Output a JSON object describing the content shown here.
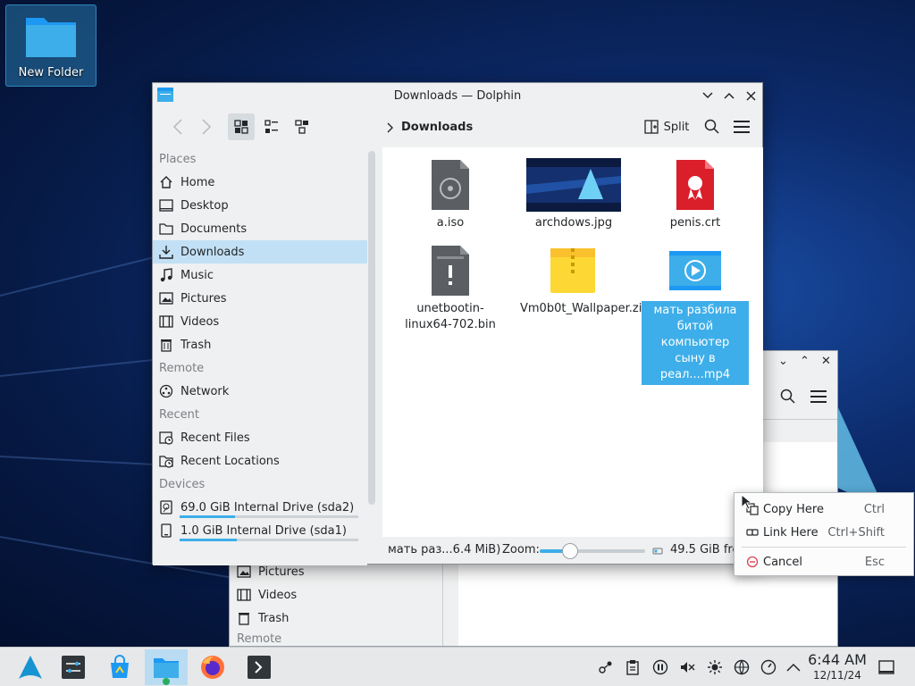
{
  "desktop": {
    "icon_label": "New Folder"
  },
  "window": {
    "title": "Downloads — Dolphin",
    "breadcrumb": "Downloads",
    "split_label": "Split"
  },
  "sidebar": {
    "places_header": "Places",
    "places": [
      "Home",
      "Desktop",
      "Documents",
      "Downloads",
      "Music",
      "Pictures",
      "Videos",
      "Trash"
    ],
    "remote_header": "Remote",
    "remote": [
      "Network"
    ],
    "recent_header": "Recent",
    "recent": [
      "Recent Files",
      "Recent Locations"
    ],
    "devices_header": "Devices",
    "devices": [
      "69.0 GiB Internal Drive (sda2)",
      "1.0 GiB Internal Drive (sda1)"
    ],
    "selected": "Downloads",
    "device_usage": [
      0.31,
      0.32
    ]
  },
  "files": [
    {
      "name": "a.iso",
      "icon": "disc-image-icon"
    },
    {
      "name": "archdows.jpg",
      "icon": "image-thumbnail"
    },
    {
      "name": "penis.crt",
      "icon": "certificate-icon"
    },
    {
      "name": "unetbootin-linux64-702.bin",
      "icon": "binary-file-icon"
    },
    {
      "name": "Vm0b0t_Wallpaper.zip",
      "icon": "zip-archive-icon"
    },
    {
      "name": "мать разбила битой компьютер сыну в реал....mp4",
      "icon": "video-file-icon",
      "selected": true
    }
  ],
  "status": {
    "selection": "мать раз...6.4 MiB)",
    "zoom_label": "Zoom:",
    "free_space": "49.5 GiB fre",
    "zoom_level": 0.29
  },
  "background_window": {
    "items": [
      "Pictures",
      "Videos",
      "Trash"
    ],
    "remote_header": "Remote"
  },
  "context_menu": {
    "items": [
      {
        "label": "Copy Here",
        "shortcut": "Ctrl",
        "icon": "copy-icon"
      },
      {
        "label": "Link Here",
        "shortcut": "Ctrl+Shift",
        "icon": "link-icon"
      },
      {
        "label": "Cancel",
        "shortcut": "Esc",
        "icon": "cancel-icon"
      }
    ]
  },
  "clock": {
    "time": "6:44 AM",
    "date": "12/11/24"
  },
  "colors": {
    "accent": "#3daee9",
    "selection_bg": "#c2e0f5"
  }
}
